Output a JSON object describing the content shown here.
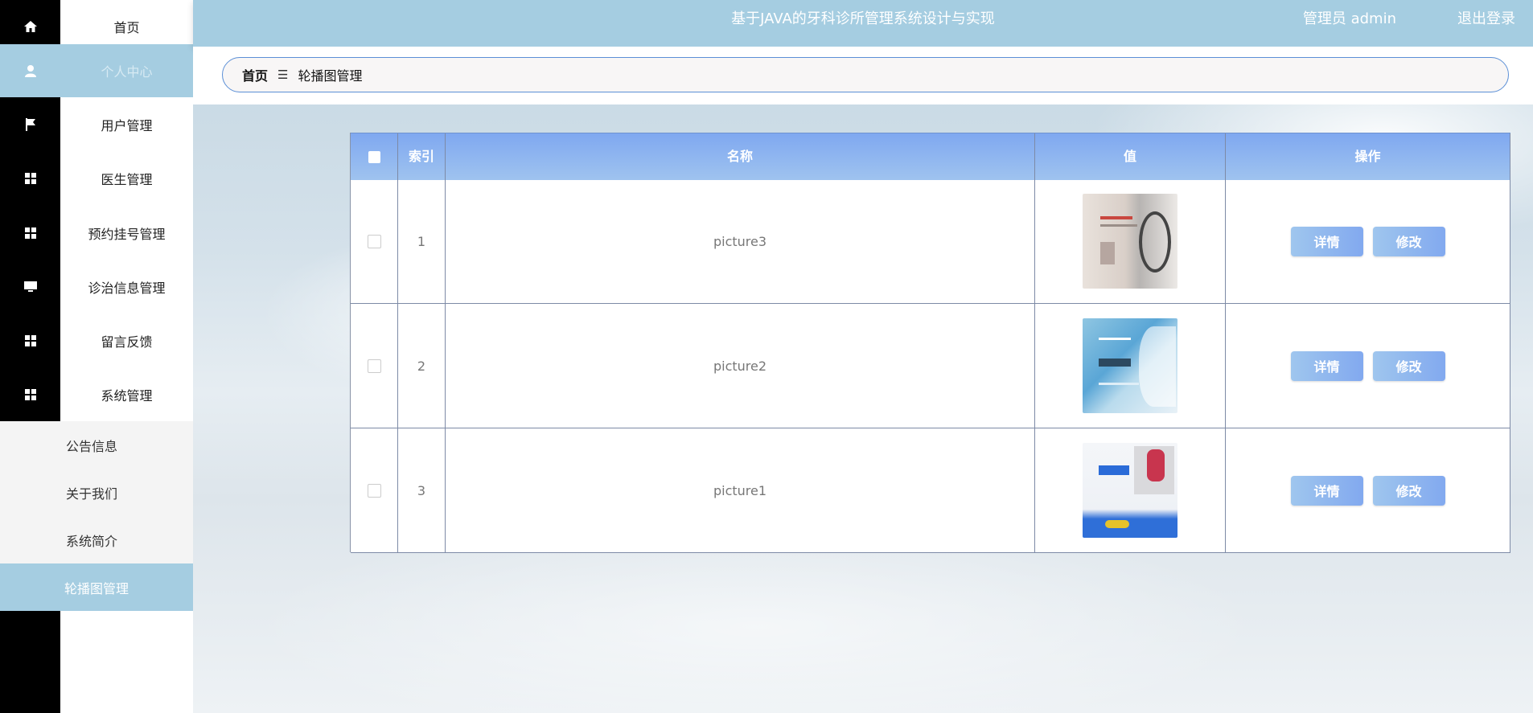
{
  "header": {
    "title": "基于JAVA的牙科诊所管理系统设计与实现",
    "user": "管理员 admin",
    "logout": "退出登录"
  },
  "sidebar": {
    "items": [
      {
        "label": "首页",
        "icon": "home-icon"
      },
      {
        "label": "个人中心",
        "icon": "user-icon"
      },
      {
        "label": "用户管理",
        "icon": "flag-icon"
      },
      {
        "label": "医生管理",
        "icon": "grid-icon"
      },
      {
        "label": "预约挂号管理",
        "icon": "grid-icon"
      },
      {
        "label": "诊治信息管理",
        "icon": "monitor-icon"
      },
      {
        "label": "留言反馈",
        "icon": "grid-icon"
      },
      {
        "label": "系统管理",
        "icon": "grid-icon"
      }
    ],
    "sub_items": [
      {
        "label": "公告信息"
      },
      {
        "label": "关于我们"
      },
      {
        "label": "系统简介"
      },
      {
        "label": "轮播图管理"
      }
    ]
  },
  "breadcrumb": {
    "home": "首页",
    "separator": "☰",
    "current": "轮播图管理"
  },
  "table": {
    "columns": [
      "索引",
      "名称",
      "值",
      "操作"
    ],
    "rows": [
      {
        "index": "1",
        "name": "picture3",
        "detail": "详情",
        "edit": "修改"
      },
      {
        "index": "2",
        "name": "picture2",
        "detail": "详情",
        "edit": "修改"
      },
      {
        "index": "3",
        "name": "picture1",
        "detail": "详情",
        "edit": "修改"
      }
    ]
  },
  "colors": {
    "accent": "#a5cde1",
    "table_header": "#7fa8f0",
    "button": "#82a9ef"
  }
}
